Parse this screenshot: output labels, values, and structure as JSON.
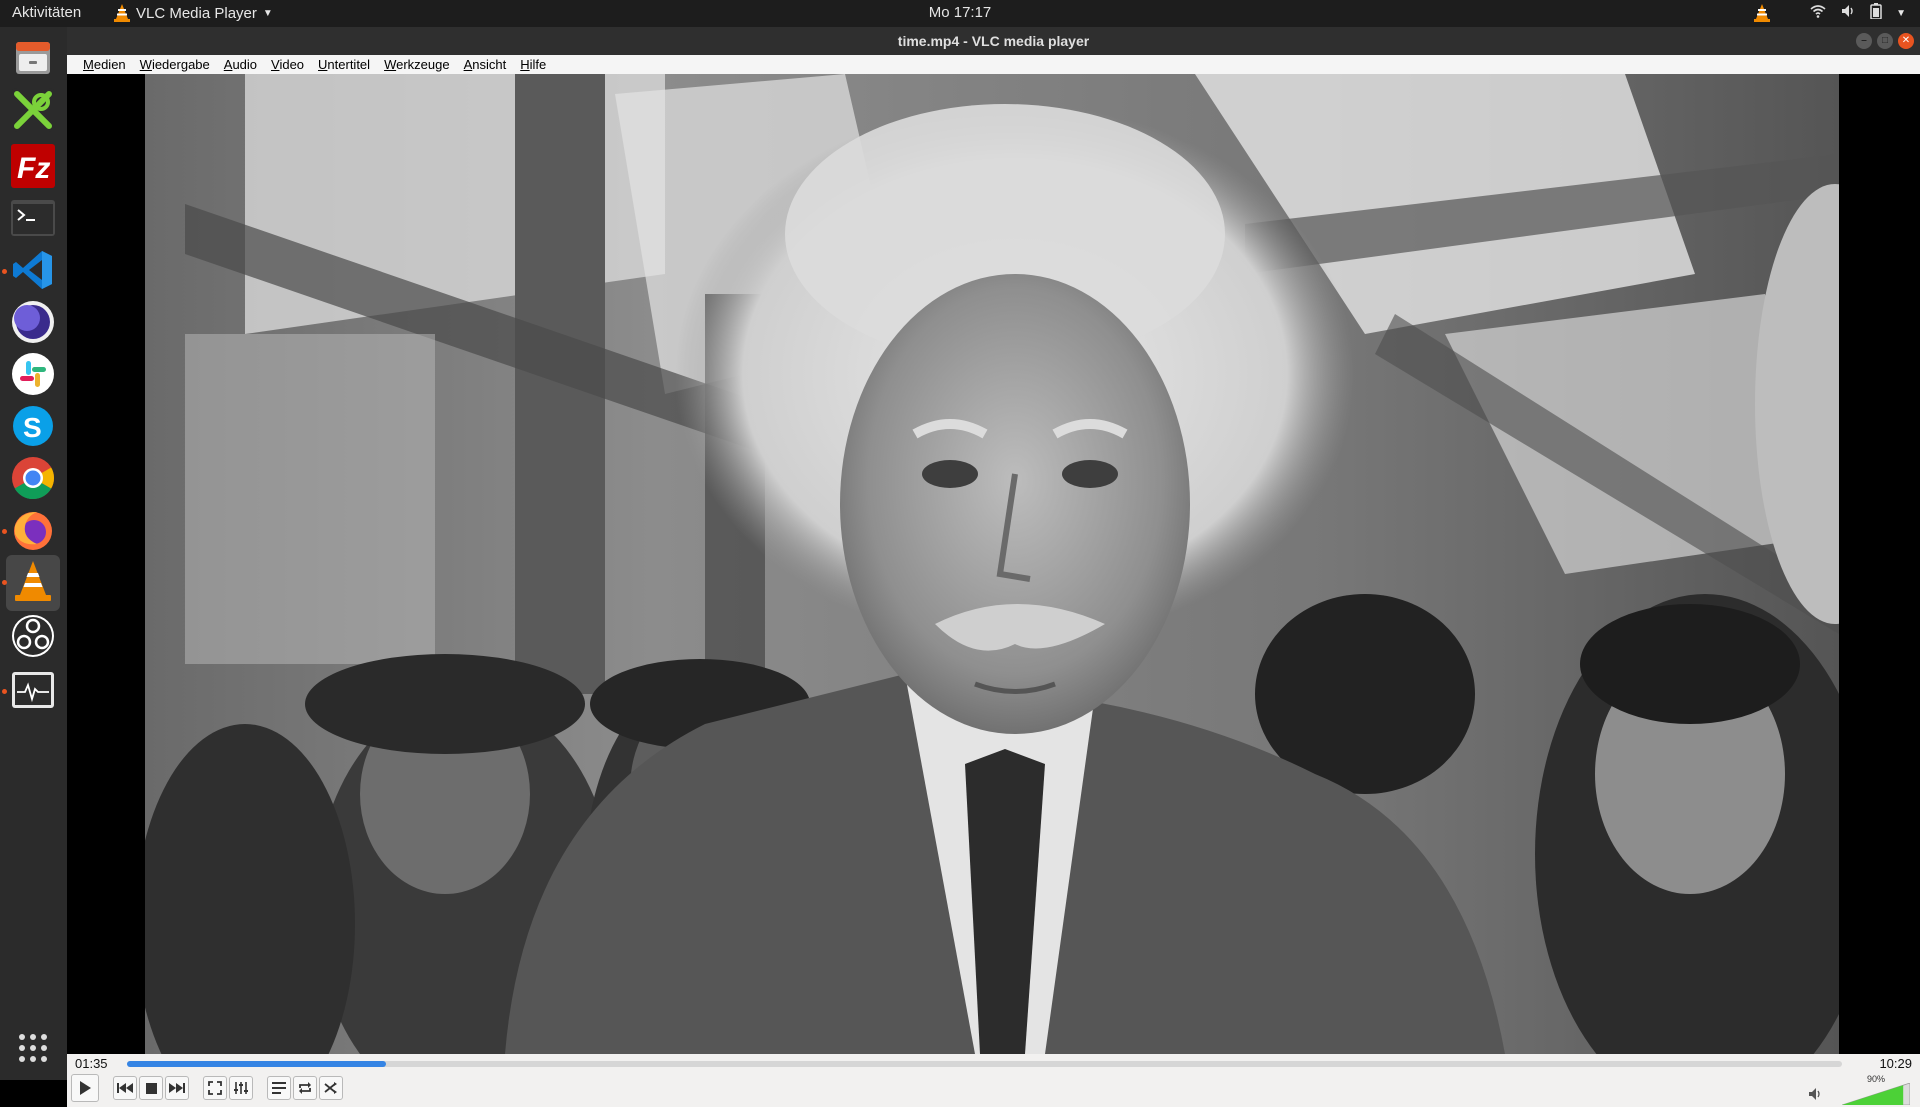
{
  "topbar": {
    "activities": "Aktivitäten",
    "app_menu": "VLC Media Player",
    "clock": "Mo 17:17"
  },
  "dock": {
    "items": [
      {
        "name": "files",
        "icon": "file-cabinet-icon"
      },
      {
        "name": "xmind",
        "icon": "xmind-icon"
      },
      {
        "name": "filezilla",
        "icon": "filezilla-icon"
      },
      {
        "name": "terminal",
        "icon": "terminal-icon"
      },
      {
        "name": "vscode",
        "icon": "vscode-icon"
      },
      {
        "name": "eclipse",
        "icon": "moon-icon"
      },
      {
        "name": "slack",
        "icon": "slack-icon"
      },
      {
        "name": "skype",
        "icon": "skype-icon"
      },
      {
        "name": "chrome",
        "icon": "chrome-icon"
      },
      {
        "name": "firefox",
        "icon": "firefox-icon"
      },
      {
        "name": "vlc",
        "icon": "vlc-cone-icon"
      },
      {
        "name": "obs",
        "icon": "obs-icon"
      },
      {
        "name": "system-monitor",
        "icon": "pulse-monitor-icon"
      }
    ]
  },
  "window": {
    "title": "time.mp4 - VLC media player"
  },
  "menubar": {
    "items": [
      {
        "first": "M",
        "rest": "edien"
      },
      {
        "first": "W",
        "rest": "iedergabe"
      },
      {
        "first": "A",
        "rest": "udio"
      },
      {
        "first": "V",
        "rest": "ideo"
      },
      {
        "first": "U",
        "rest": "ntertitel"
      },
      {
        "first": "W",
        "rest": "erkzeuge"
      },
      {
        "first": "A",
        "rest": "nsicht"
      },
      {
        "first": "H",
        "rest": "ilfe"
      }
    ]
  },
  "player": {
    "current_time": "01:35",
    "total_time": "10:29",
    "progress": 0.151,
    "volume_label": "90%",
    "volume": 0.9,
    "accent": "#3584e4"
  }
}
